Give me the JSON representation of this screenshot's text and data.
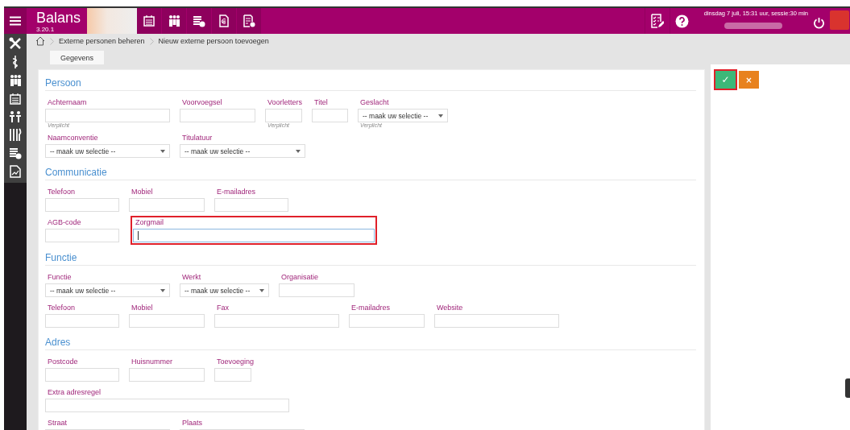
{
  "app": {
    "name": "Balans",
    "version": "3.20.1"
  },
  "session_info": "dinsdag 7 juli, 15:31 uur, sessie:30 min",
  "breadcrumb": [
    "Externe personen beheren",
    "Nieuw externe persoon toevoegen"
  ],
  "tabs": [
    {
      "label": "Gegevens",
      "selected": true
    }
  ],
  "actions": [
    {
      "kind": "save",
      "label": "✓",
      "highlighted": true
    },
    {
      "kind": "cancel",
      "label": "×",
      "highlighted": false
    }
  ],
  "sections": [
    {
      "title": "Persoon",
      "rows": [
        {
          "fields": [
            {
              "label": "Achternaam",
              "kind": "text",
              "hint": "Verplicht",
              "highlighted": false
            },
            {
              "label": "Voorvoegsel",
              "kind": "text",
              "highlighted": false
            },
            {
              "label": "Voorletters",
              "kind": "text",
              "hint": "Verplicht",
              "highlighted": false
            },
            {
              "label": "Titel",
              "kind": "text",
              "highlighted": false
            },
            {
              "label": "Geslacht",
              "kind": "select",
              "value": "-- maak uw selectie --",
              "hint": "Verplicht",
              "highlighted": false
            }
          ]
        },
        {
          "fields": [
            {
              "label": "Naamconventie",
              "kind": "select",
              "value": "-- maak uw selectie --",
              "highlighted": false
            },
            {
              "label": "Titulatuur",
              "kind": "select",
              "value": "-- maak uw selectie --",
              "highlighted": false
            }
          ]
        }
      ]
    },
    {
      "title": "Communicatie",
      "rows": [
        {
          "fields": [
            {
              "label": "Telefoon",
              "kind": "text",
              "highlighted": false
            },
            {
              "label": "Mobiel",
              "kind": "text",
              "highlighted": false
            },
            {
              "label": "E-mailadres",
              "kind": "text",
              "highlighted": false
            }
          ]
        },
        {
          "fields": [
            {
              "label": "AGB-code",
              "kind": "text",
              "highlighted": false
            },
            {
              "label": "Zorgmail",
              "kind": "text",
              "highlighted": true
            }
          ]
        }
      ]
    },
    {
      "title": "Functie",
      "rows": [
        {
          "fields": [
            {
              "label": "Functie",
              "kind": "select",
              "value": "-- maak uw selectie --",
              "highlighted": false
            },
            {
              "label": "Werkt",
              "kind": "select",
              "value": "-- maak uw selectie --",
              "highlighted": false
            },
            {
              "label": "Organisatie",
              "kind": "text",
              "highlighted": false
            }
          ]
        },
        {
          "fields": [
            {
              "label": "Telefoon",
              "kind": "text",
              "highlighted": false
            },
            {
              "label": "Mobiel",
              "kind": "text",
              "highlighted": false
            },
            {
              "label": "Fax",
              "kind": "text",
              "highlighted": false
            },
            {
              "label": "E-mailadres",
              "kind": "text",
              "highlighted": false
            },
            {
              "label": "Website",
              "kind": "text",
              "highlighted": false
            }
          ]
        }
      ]
    },
    {
      "title": "Adres",
      "rows": [
        {
          "fields": [
            {
              "label": "Postcode",
              "kind": "text",
              "highlighted": false
            },
            {
              "label": "Huisnummer",
              "kind": "text",
              "highlighted": false
            },
            {
              "label": "Toevoeging",
              "kind": "text",
              "highlighted": false
            }
          ]
        },
        {
          "fields": [
            {
              "label": "Extra adresregel",
              "kind": "text",
              "highlighted": false
            }
          ]
        },
        {
          "fields": [
            {
              "label": "Straat",
              "kind": "text",
              "highlighted": false
            },
            {
              "label": "Plaats",
              "kind": "text",
              "highlighted": false
            }
          ]
        }
      ]
    }
  ]
}
